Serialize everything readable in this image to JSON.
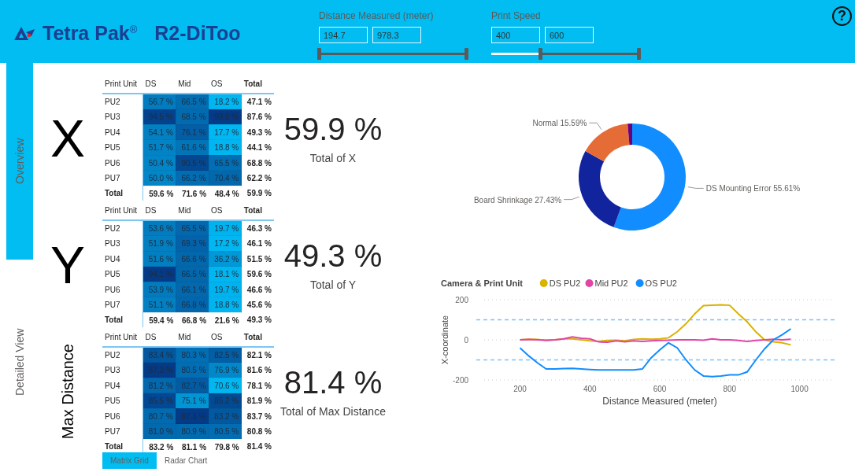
{
  "header": {
    "logo_text": "Tetra Pak$^{®}$",
    "app_title": "R2-DiToo",
    "help": "?"
  },
  "filters": [
    {
      "label": "Distance Measured (meter)",
      "min_value": "194.7",
      "max_value": "978.3",
      "thumbs": [
        {
          "level": 0
        },
        {
          "level": 1
        }
      ]
    },
    {
      "label": "Print Speed",
      "min_value": "400",
      "max_value": "600",
      "thumbs": [
        {
          "level": 0.33
        },
        {
          "level": 1
        }
      ]
    }
  ],
  "nav_tabs": [
    {
      "label": "Overview",
      "selected": true
    },
    {
      "label": "Detailed View",
      "selected": false
    }
  ],
  "matrices": [
    {
      "axis_label": "X",
      "kind": "letter",
      "columns": [
        "Print Unit",
        "DS",
        "Mid",
        "OS",
        "Total"
      ],
      "rows": [
        [
          "PU2",
          "56.7 %",
          "66.5 %",
          "18.2 %",
          "47.1 %"
        ],
        [
          "PU3",
          "94.5 %",
          "68.5 %",
          "99.9 %",
          "87.6 %"
        ],
        [
          "PU4",
          "54.1 %",
          "76.1 %",
          "17.7 %",
          "49.3 %"
        ],
        [
          "PU5",
          "51.7 %",
          "61.6 %",
          "18.8 %",
          "44.1 %"
        ],
        [
          "PU6",
          "50.4 %",
          "90.5 %",
          "65.5 %",
          "68.8 %"
        ],
        [
          "PU7",
          "50.0 %",
          "66.2 %",
          "70.4 %",
          "62.2 %"
        ]
      ],
      "total_row": [
        "Total",
        "59.6 %",
        "71.6 %",
        "48.4 %",
        "59.9 %"
      ],
      "kpi_value": "59.9 %",
      "kpi_label": "Total of X"
    },
    {
      "axis_label": "Y",
      "kind": "letter",
      "columns": [
        "Print Unit",
        "DS",
        "Mid",
        "OS",
        "Total"
      ],
      "rows": [
        [
          "PU2",
          "53.6 %",
          "65.5 %",
          "19.7 %",
          "46.3 %"
        ],
        [
          "PU3",
          "51.9 %",
          "69.3 %",
          "17.2 %",
          "46.1 %"
        ],
        [
          "PU4",
          "51.6 %",
          "66.6 %",
          "36.2 %",
          "51.5 %"
        ],
        [
          "PU5",
          "94.1 %",
          "66.5 %",
          "18.1 %",
          "59.6 %"
        ],
        [
          "PU6",
          "53.9 %",
          "66.1 %",
          "19.7 %",
          "46.6 %"
        ],
        [
          "PU7",
          "51.1 %",
          "66.8 %",
          "18.8 %",
          "45.6 %"
        ]
      ],
      "total_row": [
        "Total",
        "59.4 %",
        "66.8 %",
        "21.6 %",
        "49.3 %"
      ],
      "kpi_value": "49.3 %",
      "kpi_label": "Total of Y"
    },
    {
      "axis_label": "Max Distance",
      "kind": "vertical",
      "columns": [
        "Print Unit",
        "DS",
        "Mid",
        "OS",
        "Total"
      ],
      "rows": [
        [
          "PU2",
          "83.4 %",
          "80.3 %",
          "82.5 %",
          "82.1 %"
        ],
        [
          "PU3",
          "87.3 %",
          "80.5 %",
          "76.9 %",
          "81.6 %"
        ],
        [
          "PU4",
          "81.2 %",
          "82.7 %",
          "70.6 %",
          "78.1 %"
        ],
        [
          "PU5",
          "85.5 %",
          "75.1 %",
          "85.2 %",
          "81.9 %"
        ],
        [
          "PU6",
          "80.7 %",
          "87.3 %",
          "83.2 %",
          "83.7 %"
        ],
        [
          "PU7",
          "81.0 %",
          "80.9 %",
          "80.5 %",
          "80.8 %"
        ]
      ],
      "total_row": [
        "Total",
        "83.2 %",
        "81.1 %",
        "79.8 %",
        "81.4 %"
      ],
      "kpi_value": "81.4 %",
      "kpi_label": "Total of Max Distance"
    }
  ],
  "view_buttons": [
    {
      "label": "Matrix Grid",
      "selected": true
    },
    {
      "label": "Radar Chart",
      "selected": false
    }
  ],
  "donut": {
    "chart_data": {
      "type": "donut",
      "categories": [
        "DS Mounting Error",
        "Board Shrinkage",
        "Normal",
        null
      ],
      "values": [
        55.61,
        27.43,
        15.59,
        1.37
      ],
      "colors": [
        "#118dff",
        "#12239e",
        "#e66c37",
        "#6b007b"
      ],
      "value_labels": [
        "55.61%",
        "27.43%",
        "15.59%",
        null
      ]
    }
  },
  "line_chart": {
    "chart_data": {
      "type": "line",
      "title": "Camera & Print Unit",
      "xlabel": "Distance Measured (meter)",
      "ylabel": "X-coordinate",
      "legend": "top",
      "x": [
        200,
        225,
        250,
        275,
        300,
        325,
        350,
        375,
        400,
        425,
        450,
        475,
        500,
        525,
        550,
        575,
        600,
        625,
        650,
        675,
        700,
        725,
        750,
        775,
        800,
        825,
        850,
        875,
        900,
        925,
        950,
        975
      ],
      "series": [
        {
          "name": "DS PU2",
          "color": "#d9b300",
          "values": [
            0,
            3,
            2,
            -3,
            0,
            5,
            5,
            0,
            -5,
            -8,
            -3,
            -2,
            -5,
            2,
            5,
            3,
            5,
            10,
            40,
            80,
            130,
            170,
            172,
            175,
            172,
            130,
            90,
            40,
            0,
            -10,
            -15,
            -25
          ]
        },
        {
          "name": "Mid PU2",
          "color": "#e044a7",
          "values": [
            0,
            2,
            0,
            -2,
            0,
            5,
            15,
            8,
            5,
            -10,
            -12,
            -5,
            -10,
            -5,
            -8,
            -5,
            -3,
            -2,
            0,
            0,
            0,
            -2,
            5,
            0,
            0,
            -3,
            -8,
            -3,
            0,
            3,
            0,
            3
          ]
        },
        {
          "name": "OS PU2",
          "color": "#118dff",
          "values": [
            -40,
            -80,
            -115,
            -145,
            -145,
            -143,
            -142,
            -145,
            -148,
            -150,
            -150,
            -150,
            -150,
            -150,
            -145,
            -90,
            -50,
            -15,
            -40,
            -100,
            -150,
            -180,
            -183,
            -180,
            -175,
            -175,
            -160,
            -100,
            -45,
            0,
            25,
            55
          ]
        }
      ],
      "xlim": [
        75,
        1100
      ],
      "ylim": [
        -200,
        200
      ],
      "xticks": [
        200,
        400,
        600,
        800,
        1000
      ],
      "yticks": [
        -200,
        0,
        200
      ],
      "ref_lines": [
        {
          "axis": "y",
          "value": 100,
          "color": "#7cc2f7"
        },
        {
          "axis": "y",
          "value": -100,
          "color": "#7cc2f7"
        }
      ]
    }
  }
}
